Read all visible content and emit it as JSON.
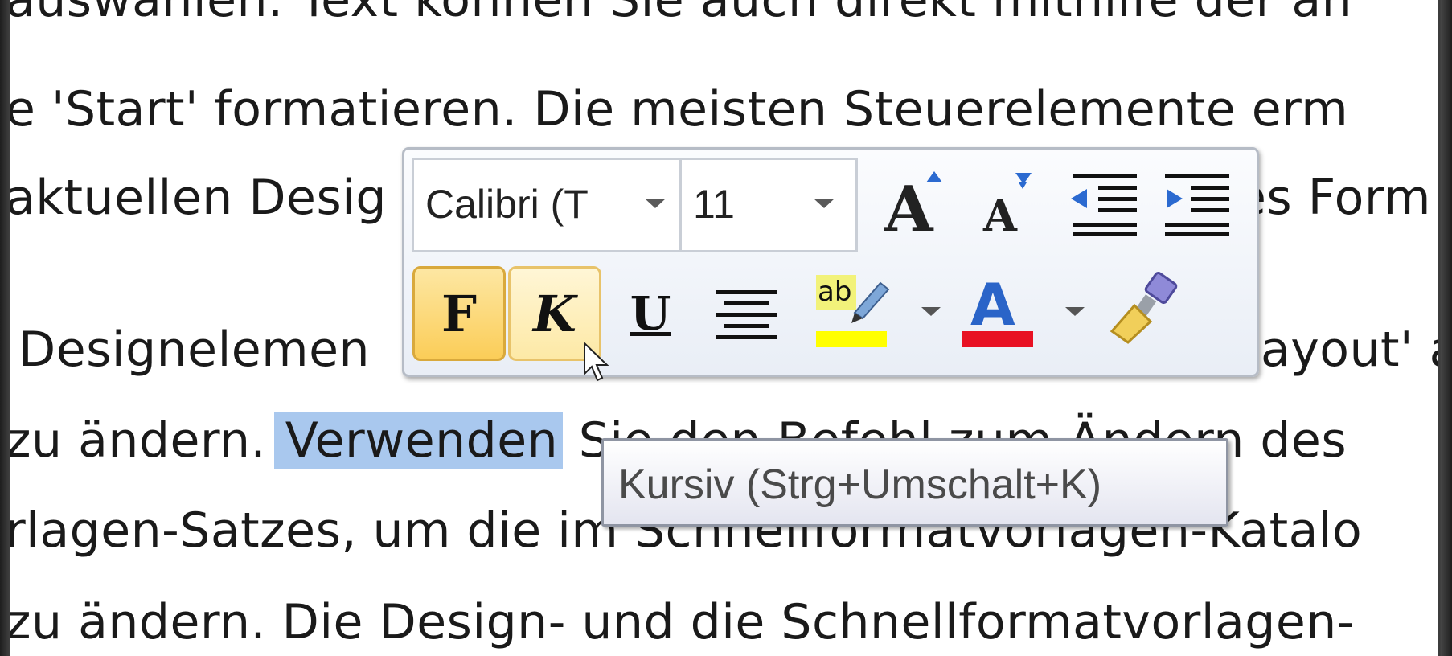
{
  "document": {
    "lines": [
      "auswählen. Text können Sie auch direkt mithilfe der an",
      "e 'Start' formatieren. Die meisten Steuerelemente erm",
      "aktuellen Desig",
      "Designelemen",
      "zu ändern. ",
      "Verwenden",
      " Sie den Befehl zum Ändern des",
      "rlagen-Satzes, um die im Schnellformatvorlagen-Katalo",
      "zu ändern. Die Design- und die Schnellformatvorlagen-"
    ],
    "line3_tail": "es Form",
    "line4_tail": "ayout' a",
    "selected_word": "Verwenden"
  },
  "mini_toolbar": {
    "font_name": "Calibri (T",
    "font_size": "11",
    "grow_font_icon": "grow-font-icon",
    "shrink_font_icon": "shrink-font-icon",
    "bold_label": "F",
    "italic_label": "K",
    "underline_label": "U",
    "highlight_label": "ab",
    "highlight_color": "#ffff00",
    "font_color_label": "A",
    "font_color": "#e81123",
    "format_painter_icon": "format-painter-icon"
  },
  "tooltip": {
    "text": "Kursiv (Strg+Umschalt+K)"
  }
}
